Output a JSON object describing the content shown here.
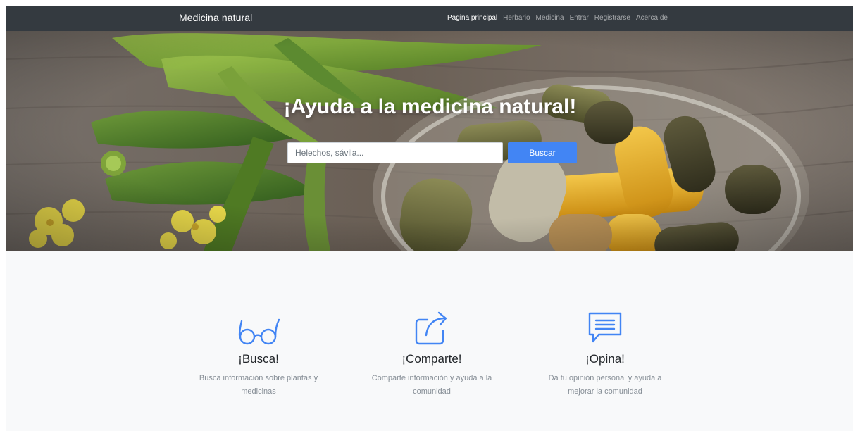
{
  "navbar": {
    "brand": "Medicina natural",
    "links": [
      {
        "label": "Pagina principal",
        "active": true
      },
      {
        "label": "Herbario",
        "active": false
      },
      {
        "label": "Medicina",
        "active": false
      },
      {
        "label": "Entrar",
        "active": false
      },
      {
        "label": "Registrarse",
        "active": false
      },
      {
        "label": "Acerca de",
        "active": false
      }
    ]
  },
  "hero": {
    "title": "¡Ayuda a la medicina natural!",
    "search_placeholder": "Helechos, sávila...",
    "search_button": "Buscar"
  },
  "features": [
    {
      "icon": "glasses-icon",
      "title": "¡Busca!",
      "text": "Busca información sobre plantas y medicinas"
    },
    {
      "icon": "share-icon",
      "title": "¡Comparte!",
      "text": "Comparte información y ayuda a la comunidad"
    },
    {
      "icon": "chat-icon",
      "title": "¡Opina!",
      "text": "Da tu opinión personal y ayuda a mejorar la comunidad"
    }
  ],
  "colors": {
    "navbar": "#343a40",
    "accent": "#4285f4",
    "page_bg": "#f8f9fa"
  }
}
